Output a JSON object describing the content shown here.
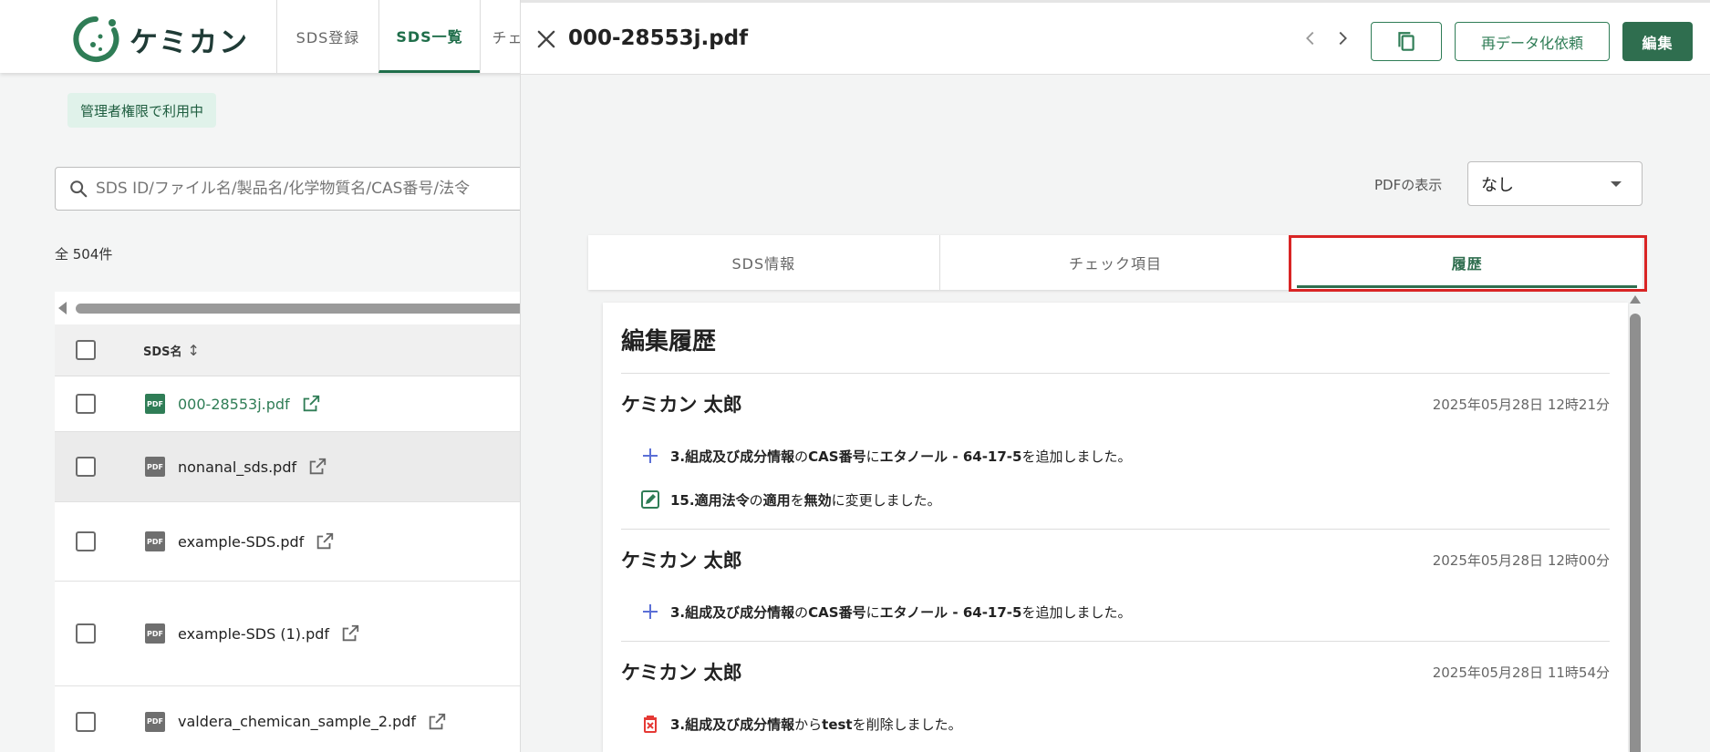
{
  "app": {
    "name": "ケミカン"
  },
  "nav": {
    "tabs": [
      {
        "label": "SDS登録"
      },
      {
        "label": "SDS一覧"
      },
      {
        "label": "チェ"
      }
    ]
  },
  "list_page": {
    "admin_badge": "管理者権限で利用中",
    "search_placeholder": "SDS ID/ファイル名/製品名/化学物質名/CAS番号/法令",
    "count": "全 504件",
    "column_header": "SDS名",
    "rows": [
      {
        "name": "000-28553j.pdf"
      },
      {
        "name": "nonanal_sds.pdf"
      },
      {
        "name": "example-SDS.pdf"
      },
      {
        "name": "example-SDS (1).pdf"
      },
      {
        "name": "valdera_chemican_sample_2.pdf"
      }
    ]
  },
  "drawer": {
    "title": "000-28553j.pdf",
    "request_button": "再データ化依頼",
    "edit_button": "編集",
    "pdf_label": "PDFの表示",
    "pdf_select_value": "なし",
    "tabs": [
      {
        "label": "SDS情報"
      },
      {
        "label": "チェック項目"
      },
      {
        "label": "履歴"
      }
    ],
    "active_tab": "履歴",
    "history": {
      "title": "編集履歴",
      "entries": [
        {
          "user": "ケミカン 太郎",
          "date": "2025年05月28日 12時21分",
          "changes": [
            {
              "type": "add",
              "section": "3.組成及び成分情報",
              "p1": "の",
              "field": "CAS番号",
              "p2": "に",
              "value": "エタノール - 64-17-5",
              "p3": "を追加しました。"
            },
            {
              "type": "edit",
              "section": "15.適用法令",
              "p1": "の",
              "field": "適用",
              "p2": "を",
              "value": "無効",
              "p3": "に変更しました。"
            }
          ]
        },
        {
          "user": "ケミカン 太郎",
          "date": "2025年05月28日 12時00分",
          "changes": [
            {
              "type": "add",
              "section": "3.組成及び成分情報",
              "p1": "の",
              "field": "CAS番号",
              "p2": "に",
              "value": "エタノール - 64-17-5",
              "p3": "を追加しました。"
            }
          ]
        },
        {
          "user": "ケミカン 太郎",
          "date": "2025年05月28日 11時54分",
          "changes": [
            {
              "type": "delete",
              "section": "3.組成及び成分情報",
              "p1": "から",
              "field": "test",
              "p2": "",
              "value": "",
              "p3": "を削除しました。"
            }
          ]
        }
      ]
    }
  },
  "colors": {
    "brand_green": "#2f6e4f",
    "link_green": "#2f7d56",
    "highlight_red": "#d92525",
    "add_icon": "#5b6fd6",
    "delete_icon": "#e53935"
  }
}
